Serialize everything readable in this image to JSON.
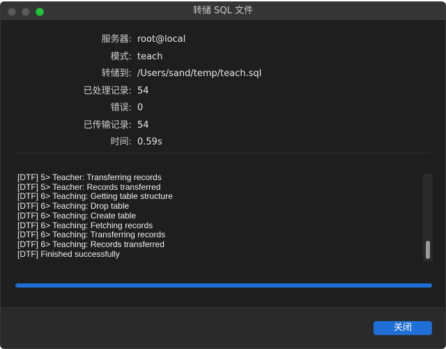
{
  "window": {
    "title": "转储 SQL 文件"
  },
  "info": [
    {
      "label": "服务器:",
      "value": "root@local"
    },
    {
      "label": "模式:",
      "value": "teach"
    },
    {
      "label": "转储到:",
      "value": "/Users/sand/temp/teach.sql"
    },
    {
      "label": "已处理记录:",
      "value": "54"
    },
    {
      "label": "错误:",
      "value": "0"
    },
    {
      "label": "已传输记录:",
      "value": "54"
    },
    {
      "label": "时间:",
      "value": "0.59s"
    }
  ],
  "log": [
    "[DTF] 5> Teacher: Transferring records",
    "[DTF] 5> Teacher: Records transferred",
    "[DTF] 6> Teaching: Getting table structure",
    "[DTF] 6> Teaching: Drop table",
    "[DTF] 6> Teaching: Create table",
    "[DTF] 6> Teaching: Fetching records",
    "[DTF] 6> Teaching: Transferring records",
    "[DTF] 6> Teaching: Records transferred",
    "[DTF] Finished successfully"
  ],
  "progress": {
    "percent": 100,
    "color": "#1f6fd6"
  },
  "buttons": {
    "close_label": "关闭"
  }
}
